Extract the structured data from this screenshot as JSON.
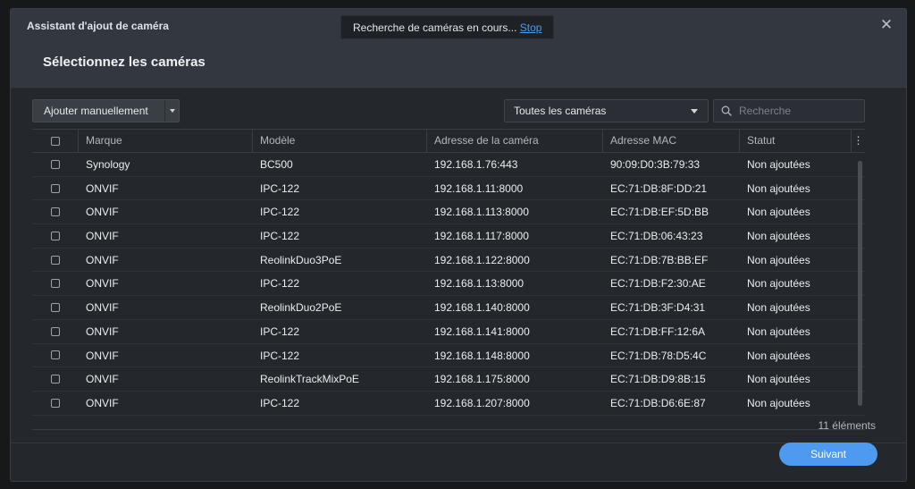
{
  "window": {
    "title": "Assistant d'ajout de caméra",
    "close_symbol": "✕"
  },
  "page": {
    "title": "Sélectionnez les caméras"
  },
  "toast": {
    "text": "Recherche de caméras en cours... ",
    "link": "Stop"
  },
  "toolbar": {
    "add_manual_label": "Ajouter manuellement",
    "filter_selected": "Toutes les caméras",
    "search_placeholder": "Recherche"
  },
  "table": {
    "headers": [
      "Marque",
      "Modèle",
      "Adresse de la caméra",
      "Adresse MAC",
      "Statut"
    ],
    "more_symbol": "⋮",
    "rows": [
      {
        "brand": "Synology",
        "model": "BC500",
        "address": "192.168.1.76:443",
        "mac": "90:09:D0:3B:79:33",
        "status": "Non ajoutées"
      },
      {
        "brand": "ONVIF",
        "model": "IPC-122",
        "address": "192.168.1.11:8000",
        "mac": "EC:71:DB:8F:DD:21",
        "status": "Non ajoutées"
      },
      {
        "brand": "ONVIF",
        "model": "IPC-122",
        "address": "192.168.1.113:8000",
        "mac": "EC:71:DB:EF:5D:BB",
        "status": "Non ajoutées"
      },
      {
        "brand": "ONVIF",
        "model": "IPC-122",
        "address": "192.168.1.117:8000",
        "mac": "EC:71:DB:06:43:23",
        "status": "Non ajoutées"
      },
      {
        "brand": "ONVIF",
        "model": "ReolinkDuo3PoE",
        "address": "192.168.1.122:8000",
        "mac": "EC:71:DB:7B:BB:EF",
        "status": "Non ajoutées"
      },
      {
        "brand": "ONVIF",
        "model": "IPC-122",
        "address": "192.168.1.13:8000",
        "mac": "EC:71:DB:F2:30:AE",
        "status": "Non ajoutées"
      },
      {
        "brand": "ONVIF",
        "model": "ReolinkDuo2PoE",
        "address": "192.168.1.140:8000",
        "mac": "EC:71:DB:3F:D4:31",
        "status": "Non ajoutées"
      },
      {
        "brand": "ONVIF",
        "model": "IPC-122",
        "address": "192.168.1.141:8000",
        "mac": "EC:71:DB:FF:12:6A",
        "status": "Non ajoutées"
      },
      {
        "brand": "ONVIF",
        "model": "IPC-122",
        "address": "192.168.1.148:8000",
        "mac": "EC:71:DB:78:D5:4C",
        "status": "Non ajoutées"
      },
      {
        "brand": "ONVIF",
        "model": "ReolinkTrackMixPoE",
        "address": "192.168.1.175:8000",
        "mac": "EC:71:DB:D9:8B:15",
        "status": "Non ajoutées"
      },
      {
        "brand": "ONVIF",
        "model": "IPC-122",
        "address": "192.168.1.207:8000",
        "mac": "EC:71:DB:D6:6E:87",
        "status": "Non ajoutées"
      }
    ],
    "count_label": "11 éléments"
  },
  "footer": {
    "next_label": "Suivant"
  },
  "colors": {
    "accent": "#4e9af0",
    "link": "#4a9df0",
    "dialog_bg": "#24272c",
    "header_bg": "#333840"
  },
  "icons": {
    "close": "close-icon",
    "search": "search-icon",
    "more": "more-vertical-icon",
    "dropdown": "chevron-down-icon"
  }
}
